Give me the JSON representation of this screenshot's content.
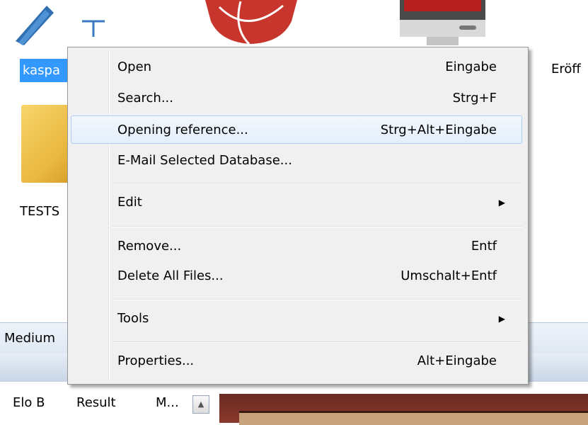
{
  "desktop": {
    "selected_label": "kaspa",
    "right_label": "Eröff",
    "folder_label": "TESTS"
  },
  "strip": {
    "label": "Medium"
  },
  "table_headers": [
    "Elo B",
    "Result",
    "M..."
  ],
  "menu": {
    "items": [
      {
        "label": "Open",
        "shortcut": "Eingabe"
      },
      {
        "label": "Search...",
        "shortcut": "Strg+F"
      },
      {
        "label": "Opening reference...",
        "shortcut": "Strg+Alt+Eingabe"
      },
      {
        "label": "E-Mail Selected Database...",
        "shortcut": ""
      },
      {
        "label": "Edit",
        "shortcut": ""
      },
      {
        "label": "Remove...",
        "shortcut": "Entf"
      },
      {
        "label": "Delete All Files...",
        "shortcut": "Umschalt+Entf"
      },
      {
        "label": "Tools",
        "shortcut": ""
      },
      {
        "label": "Properties...",
        "shortcut": "Alt+Eingabe"
      }
    ],
    "highlight_color": "#e4eefb",
    "background_color": "#f0f0f0"
  },
  "icons": {
    "pen": "pen-icon",
    "globe": "globe-icon",
    "monitor": "monitor-icon",
    "folder": "folder-icon",
    "submenu": "chevron-right-icon",
    "scroll": "scroll-up-icon"
  },
  "colors": {
    "selection": "#3399ff"
  }
}
